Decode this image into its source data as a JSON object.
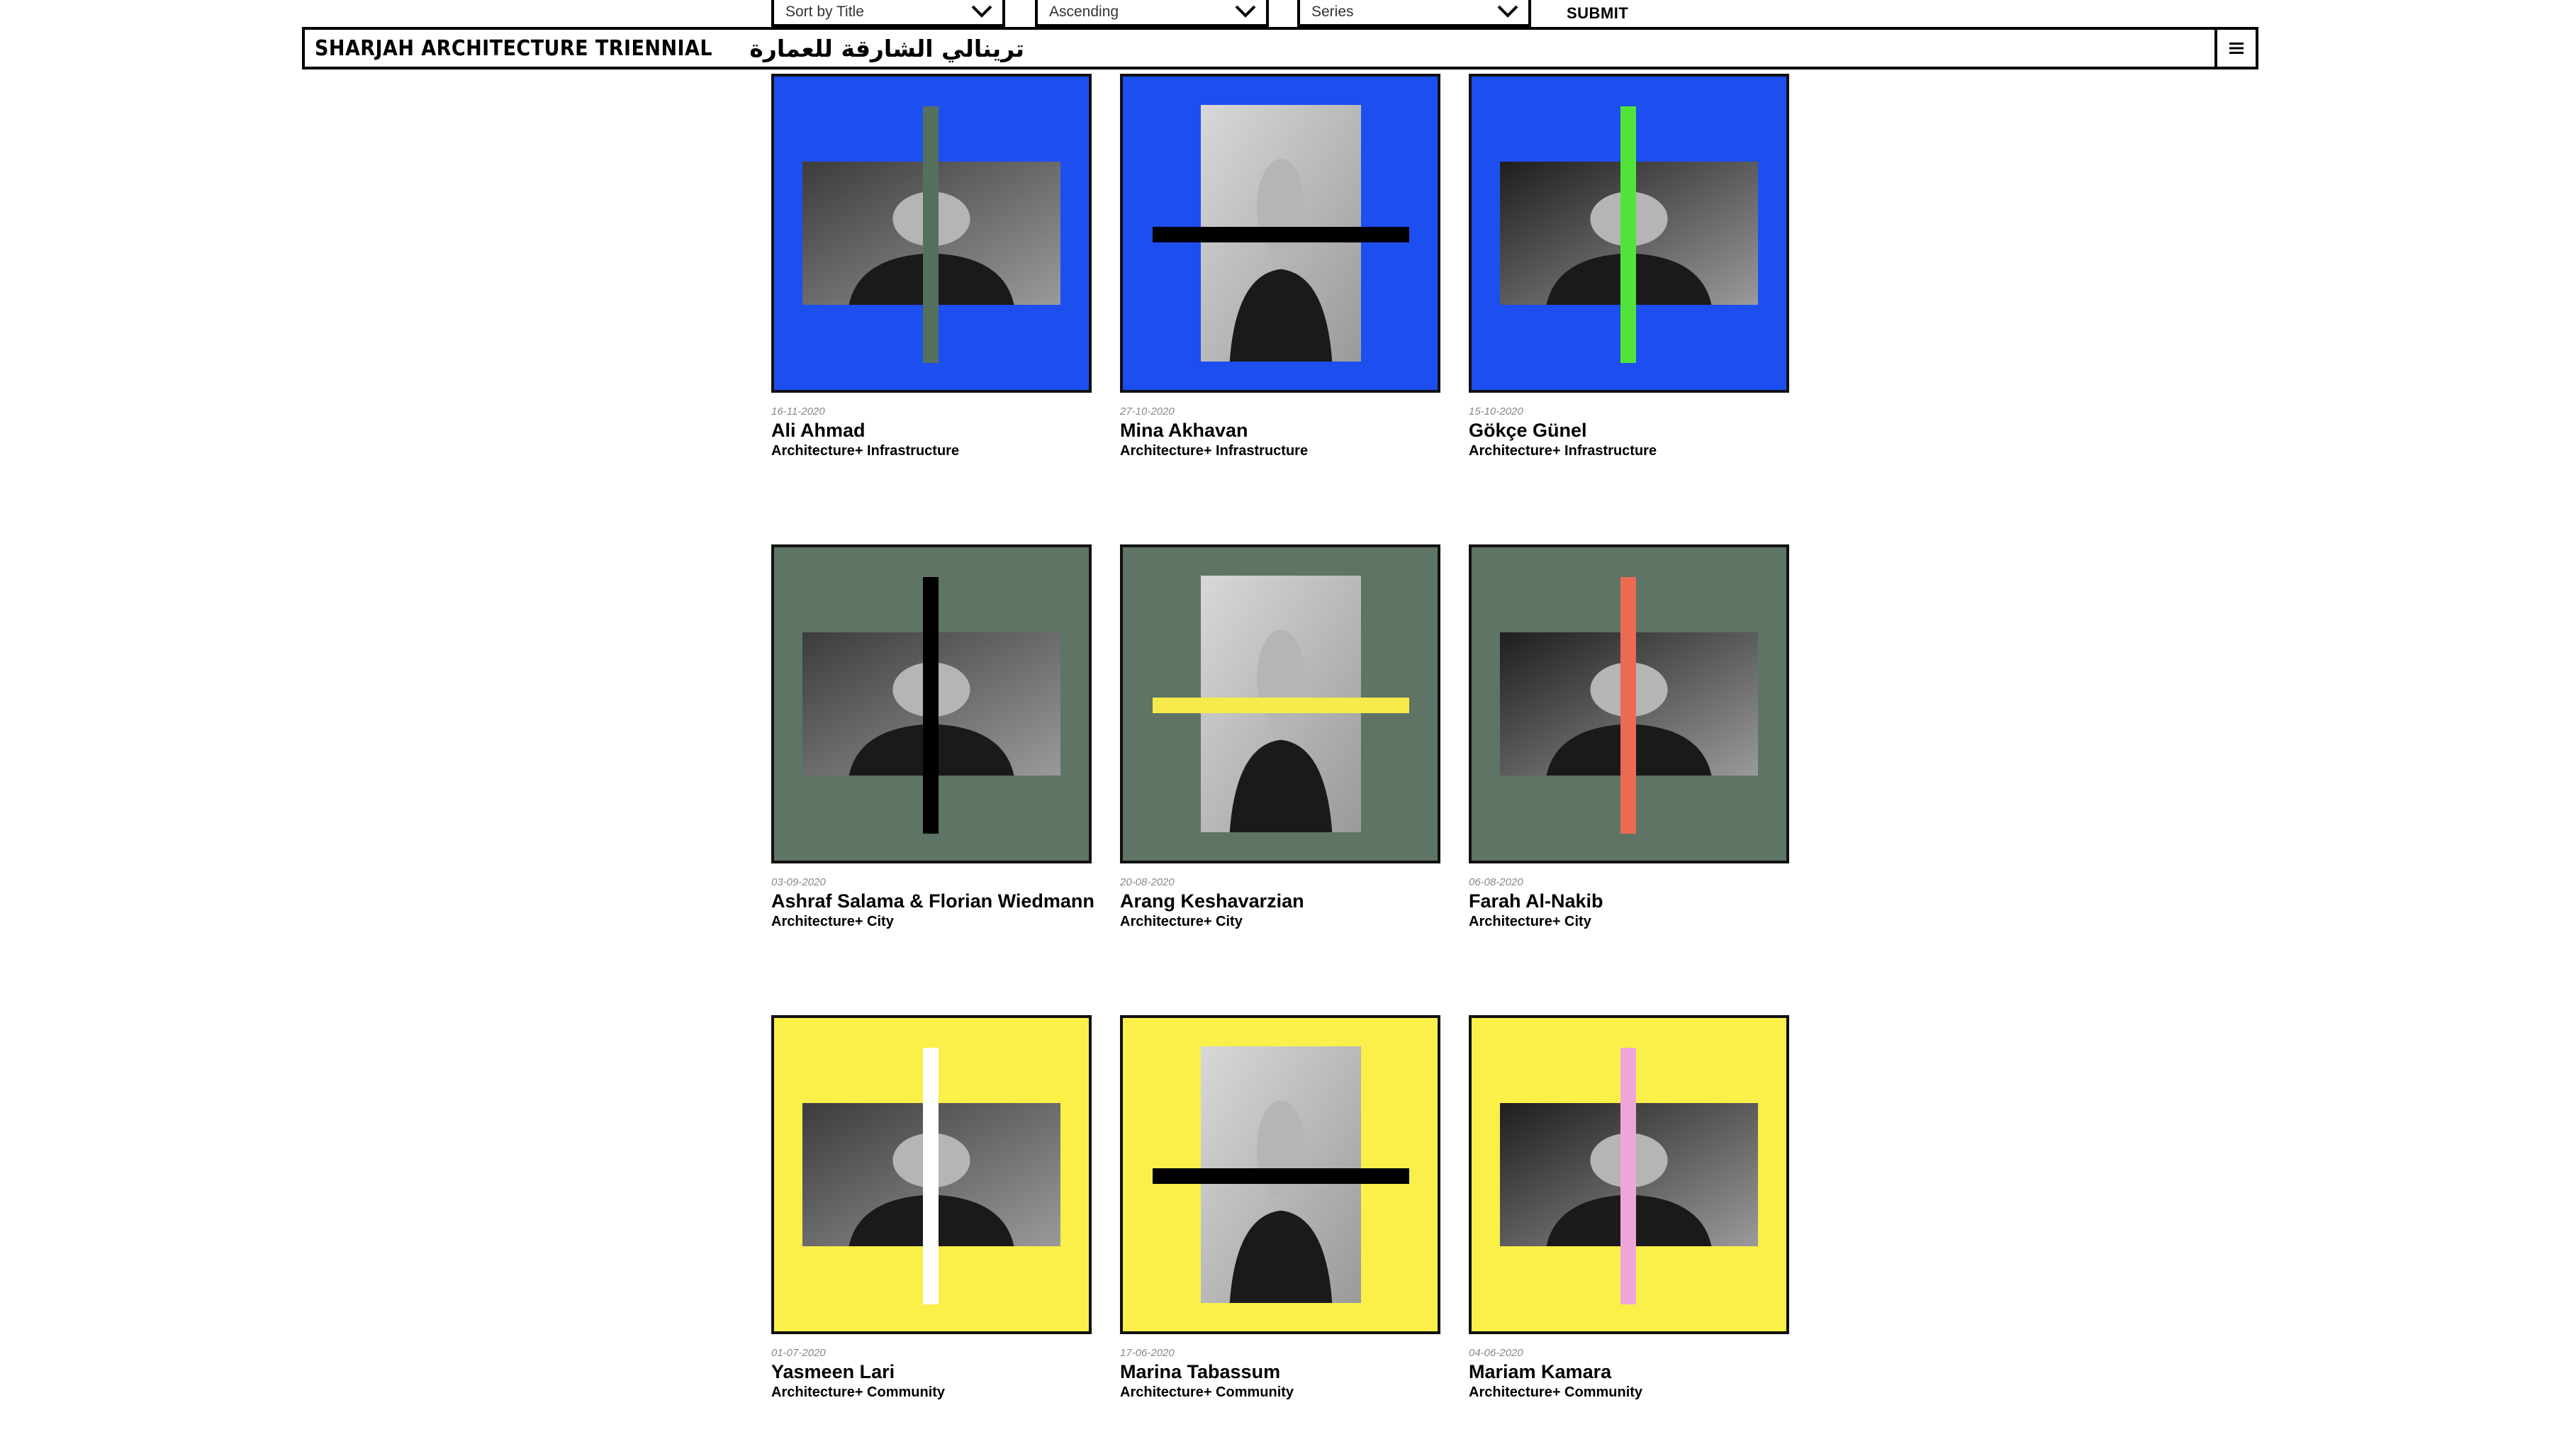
{
  "filters": {
    "sort_by": "Sort by Title",
    "order": "Ascending",
    "series": "Series",
    "submit_label": "SUBMIT"
  },
  "header": {
    "site_name_en": "SHARJAH ARCHITECTURE TRIENNIAL",
    "site_name_ar": "الشارقة للعمارة",
    "site_name_ar_2": "ترينالي",
    "menu_icon": "hamburger-icon"
  },
  "colors": {
    "blue": "#1d4ff0",
    "sage": "#5e7465",
    "yellow": "#fbef4a",
    "bar_sage": "#55705c",
    "bar_green": "#52e33a",
    "bar_black": "#000000",
    "bar_yellow": "#f6eb4a",
    "bar_coral": "#ec6a52",
    "bar_white": "#ffffff",
    "bar_pink": "#eea6d8"
  },
  "cards": [
    {
      "date": "16-11-2020",
      "name": "Ali Ahmad",
      "series": "Architecture+ Infrastructure",
      "bg": "blue",
      "bar": "bar_sage",
      "bar_orientation": "vertical",
      "photo_shape": "wide"
    },
    {
      "date": "27-10-2020",
      "name": "Mina Akhavan",
      "series": "Architecture+ Infrastructure",
      "bg": "blue",
      "bar": "bar_black",
      "bar_orientation": "horizontal",
      "photo_shape": "tall"
    },
    {
      "date": "15-10-2020",
      "name": "Gökçe Günel",
      "series": "Architecture+ Infrastructure",
      "bg": "blue",
      "bar": "bar_green",
      "bar_orientation": "vertical",
      "photo_shape": "wide"
    },
    {
      "date": "03-09-2020",
      "name": "Ashraf Salama & Florian Wiedmann",
      "series": "Architecture+ City",
      "bg": "sage",
      "bar": "bar_black",
      "bar_orientation": "vertical",
      "photo_shape": "wide"
    },
    {
      "date": "20-08-2020",
      "name": "Arang Keshavarzian",
      "series": "Architecture+ City",
      "bg": "sage",
      "bar": "bar_yellow",
      "bar_orientation": "horizontal",
      "photo_shape": "tall"
    },
    {
      "date": "06-08-2020",
      "name": "Farah Al-Nakib",
      "series": "Architecture+ City",
      "bg": "sage",
      "bar": "bar_coral",
      "bar_orientation": "vertical",
      "photo_shape": "wide"
    },
    {
      "date": "01-07-2020",
      "name": "Yasmeen Lari",
      "series": "Architecture+ Community",
      "bg": "yellow",
      "bar": "bar_white",
      "bar_orientation": "vertical",
      "photo_shape": "wide"
    },
    {
      "date": "17-06-2020",
      "name": "Marina Tabassum",
      "series": "Architecture+ Community",
      "bg": "yellow",
      "bar": "bar_black",
      "bar_orientation": "horizontal",
      "photo_shape": "tall"
    },
    {
      "date": "04-06-2020",
      "name": "Mariam Kamara",
      "series": "Architecture+ Community",
      "bg": "yellow",
      "bar": "bar_pink",
      "bar_orientation": "vertical",
      "photo_shape": "wide"
    }
  ]
}
